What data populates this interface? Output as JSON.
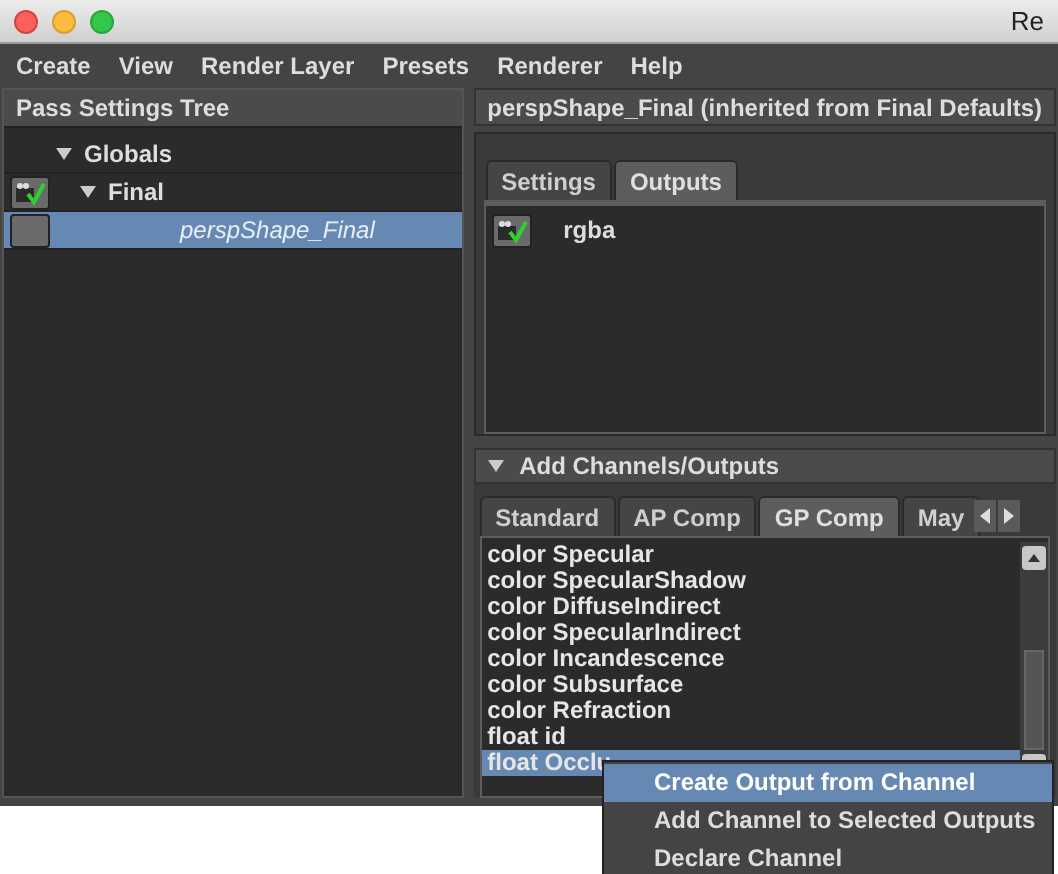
{
  "title_bar": {
    "title": "Re"
  },
  "menu": [
    "Create",
    "View",
    "Render Layer",
    "Presets",
    "Renderer",
    "Help"
  ],
  "pass_tree": {
    "title": "Pass Settings Tree",
    "items": [
      {
        "label": "Globals",
        "expanded": true,
        "children": [
          {
            "label": "Final",
            "expanded": true,
            "checked": true,
            "selected": false,
            "children": [
              {
                "label": "perspShape_Final",
                "checked": false,
                "selected": true
              }
            ]
          }
        ]
      }
    ]
  },
  "outputs_panel": {
    "title": "perspShape_Final (inherited from Final Defaults)",
    "tabs": [
      {
        "label": "Settings",
        "selected": false
      },
      {
        "label": "Outputs",
        "selected": true
      }
    ],
    "outputs": [
      {
        "label": "rgba",
        "checked": true
      }
    ]
  },
  "channels_panel": {
    "title": "Add Channels/Outputs",
    "expanded": true,
    "tabs": [
      {
        "label": "Standard",
        "selected": false
      },
      {
        "label": "AP Comp",
        "selected": false
      },
      {
        "label": "GP Comp",
        "selected": true
      },
      {
        "label": "May",
        "selected": false
      }
    ],
    "items": [
      {
        "label": "color Specular",
        "selected": false
      },
      {
        "label": "color SpecularShadow",
        "selected": false
      },
      {
        "label": "color DiffuseIndirect",
        "selected": false
      },
      {
        "label": "color SpecularIndirect",
        "selected": false
      },
      {
        "label": "color Incandescence",
        "selected": false
      },
      {
        "label": "color Subsurface",
        "selected": false
      },
      {
        "label": "color Refraction",
        "selected": false
      },
      {
        "label": "float id",
        "selected": false
      },
      {
        "label": "float Occlu",
        "selected": true
      }
    ]
  },
  "context_menu": [
    {
      "label": "Create Output from Channel",
      "selected": true
    },
    {
      "label": "Add Channel to Selected Outputs",
      "selected": false
    },
    {
      "label": "Declare Channel",
      "selected": false
    }
  ]
}
